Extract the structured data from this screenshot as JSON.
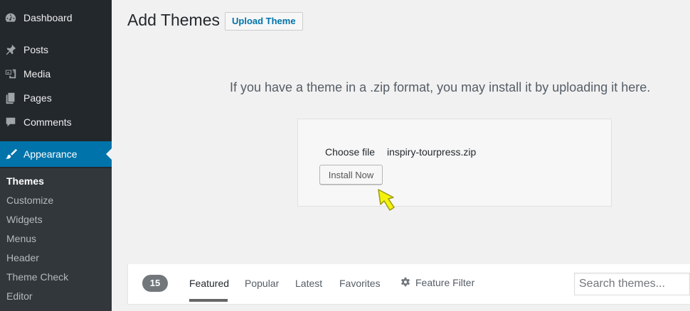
{
  "sidebar": {
    "items": [
      {
        "label": "Dashboard",
        "icon": "dashboard-icon"
      },
      {
        "label": "Posts",
        "icon": "pin-icon"
      },
      {
        "label": "Media",
        "icon": "media-icon"
      },
      {
        "label": "Pages",
        "icon": "pages-icon"
      },
      {
        "label": "Comments",
        "icon": "comment-icon"
      },
      {
        "label": "Appearance",
        "icon": "brush-icon",
        "active": true
      }
    ],
    "submenu": [
      "Themes",
      "Customize",
      "Widgets",
      "Menus",
      "Header",
      "Theme Check",
      "Editor"
    ],
    "active_color": "#0073aa"
  },
  "header": {
    "title": "Add Themes",
    "upload_button": "Upload Theme"
  },
  "upload": {
    "help_text": "If you have a theme in a .zip format, you may install it by uploading it here.",
    "choose_file": "Choose file",
    "file_name": "inspiry-tourpress.zip",
    "install_button": "Install Now"
  },
  "filter_bar": {
    "count": "15",
    "tabs": [
      "Featured",
      "Popular",
      "Latest",
      "Favorites"
    ],
    "feature_filter": "Feature Filter",
    "search_placeholder": "Search themes..."
  }
}
